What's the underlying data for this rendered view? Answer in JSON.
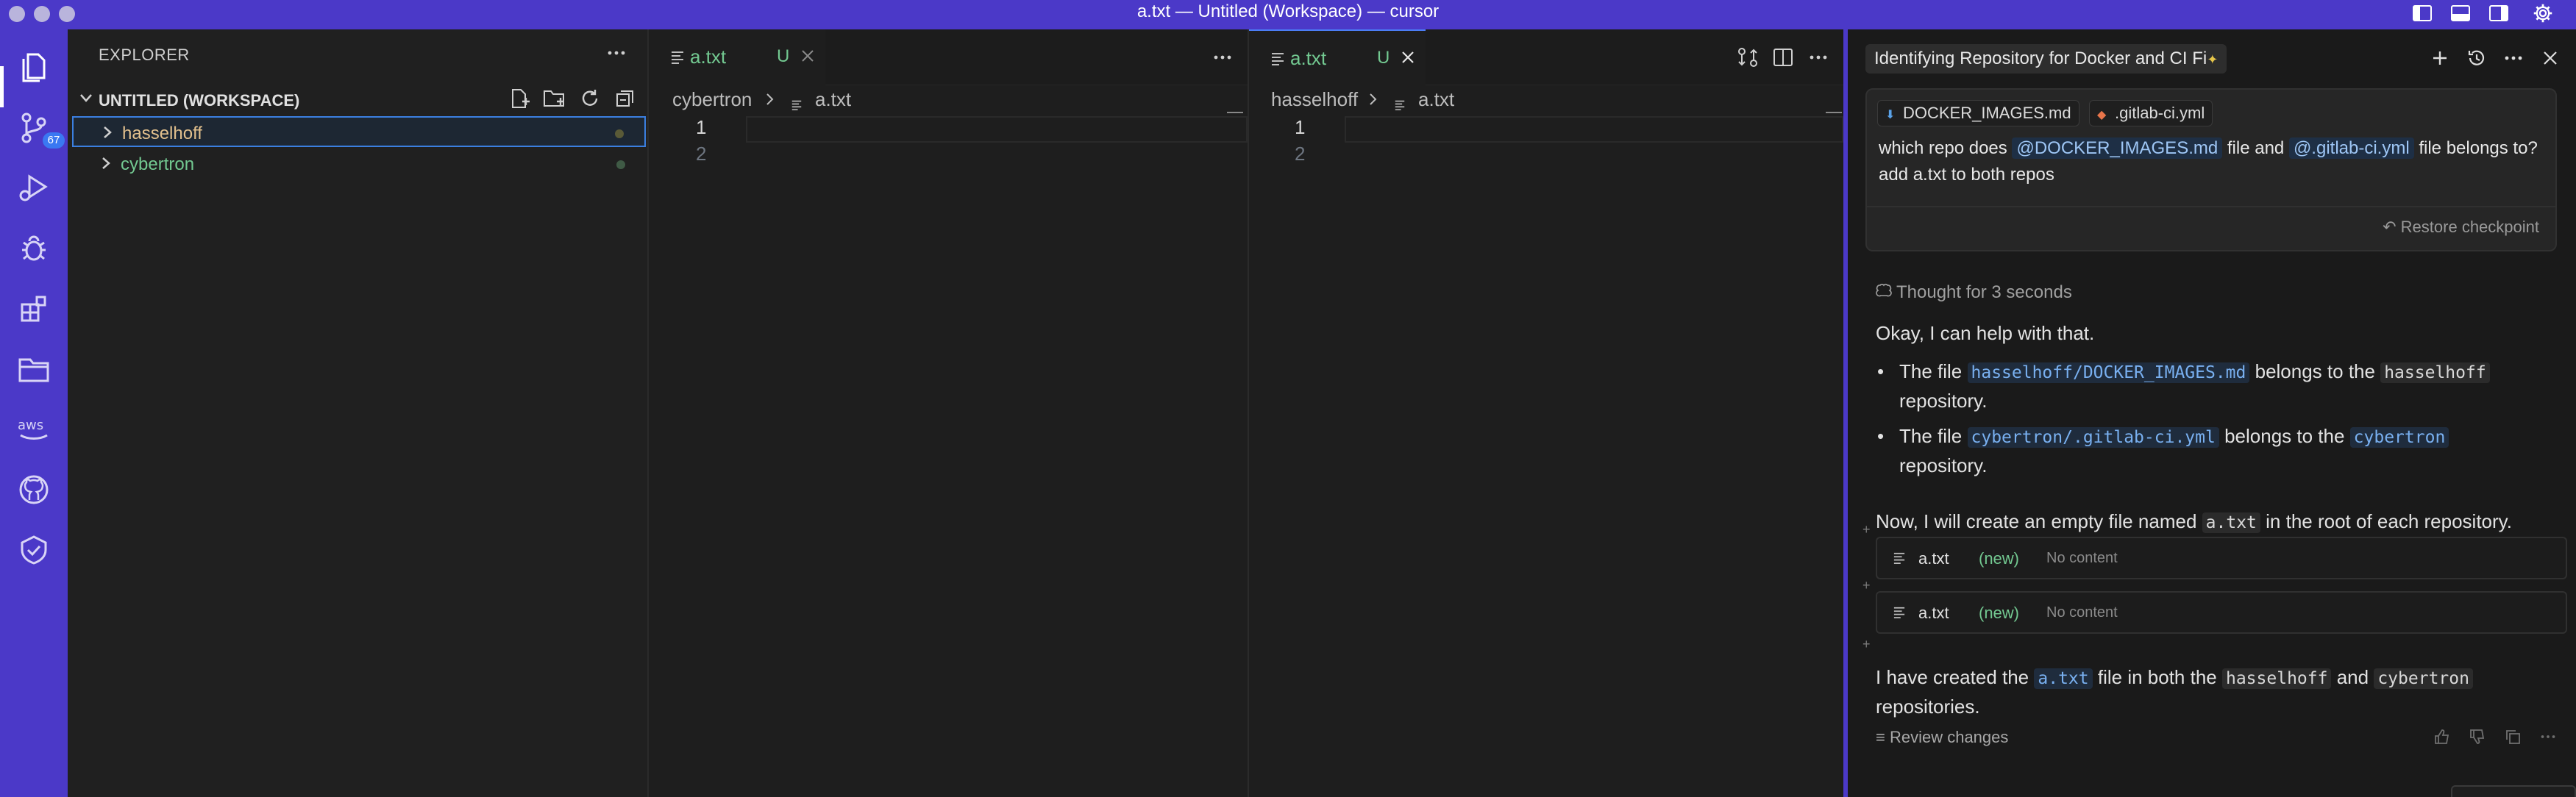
{
  "window": {
    "title": "a.txt — Untitled (Workspace) — cursor"
  },
  "activity_bar": {
    "scm_badge": "67",
    "items": [
      "explorer",
      "source-control",
      "run-and-debug",
      "debug",
      "extensions",
      "remote-explorer",
      "aws",
      "github",
      "testing"
    ]
  },
  "sidebar": {
    "title": "EXPLORER",
    "workspace_label": "UNTITLED (WORKSPACE)",
    "folders": [
      {
        "label": "hasselhoff",
        "color": "#e2c08d",
        "dot_color": "#5a5a37"
      },
      {
        "label": "cybertron",
        "color": "#73c991",
        "dot_color": "#3f5a45"
      }
    ]
  },
  "editor_left": {
    "tab": {
      "name": "a.txt",
      "status": "U"
    },
    "breadcrumb": {
      "folder": "cybertron",
      "file": "a.txt"
    },
    "lines": [
      "1",
      "2"
    ]
  },
  "editor_right": {
    "tab": {
      "name": "a.txt",
      "status": "U"
    },
    "breadcrumb": {
      "folder": "hasselhoff",
      "file": "a.txt"
    },
    "lines": [
      "1",
      "2"
    ]
  },
  "chat": {
    "title": "Identifying Repository for Docker and CI Fi",
    "user": {
      "context_pills": [
        "DOCKER_IMAGES.md",
        ".gitlab-ci.yml"
      ],
      "text_1": "which repo does",
      "mention_1": "@DOCKER_IMAGES.md",
      "text_2": "file and",
      "mention_2": "@.gitlab-ci.yml",
      "text_3": "file belongs to? add a.txt to both repos",
      "restore": "Restore checkpoint"
    },
    "thought": "Thought for 3 seconds",
    "intro": "Okay, I can help with that.",
    "bullet_1": {
      "pre": "The file",
      "path": "hasselhoff/DOCKER_IMAGES.md",
      "mid": "belongs to the",
      "repo": "hasselhoff",
      "post": "repository."
    },
    "bullet_2": {
      "pre": "The file",
      "path": "cybertron/.gitlab-ci.yml",
      "mid": "belongs to the",
      "repo": "cybertron",
      "post": "repository."
    },
    "plan": {
      "pre": "Now, I will create an empty file named",
      "code": "a.txt",
      "post": "in the root of each repository."
    },
    "file_cards": [
      {
        "name": "a.txt",
        "tag": "(new)",
        "content": "No content"
      },
      {
        "name": "a.txt",
        "tag": "(new)",
        "content": "No content"
      }
    ],
    "summary": {
      "pre": "I have created the",
      "code": "a.txt",
      "mid": "file in both the",
      "repo1": "hasselhoff",
      "and": "and",
      "repo2": "cybertron",
      "post": "repositories."
    },
    "review": "Review changes"
  },
  "colors": {
    "accent": "#4b39c8",
    "added": "#73c991",
    "modified": "#e2c08d"
  }
}
